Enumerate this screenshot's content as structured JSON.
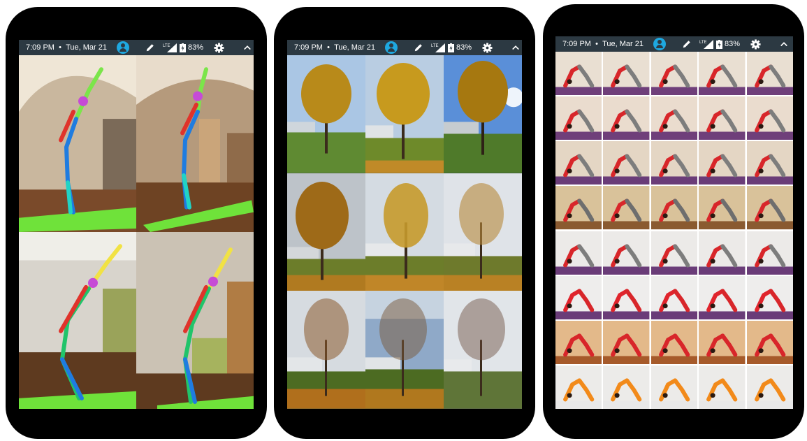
{
  "status_bar": {
    "time": "7:09 PM",
    "separator": "•",
    "date": "Tue, Mar 21",
    "battery": "83%"
  },
  "icons": [
    "account-circle-icon",
    "pencil-icon",
    "lte-signal-icon",
    "battery-icon",
    "gear-icon",
    "chevron-up-icon"
  ],
  "phones": [
    {
      "name": "pose-estimation-gallery",
      "columns": 2,
      "rows": 2
    },
    {
      "name": "tree-photo-gallery",
      "columns": 3,
      "rows": 3
    },
    {
      "name": "yoga-thumbnail-gallery",
      "columns": 5,
      "rows": 8
    }
  ],
  "colors": {
    "status_bar": "#2c3942",
    "avatar": "#1ea8e0",
    "mat": "#6fe23a"
  }
}
